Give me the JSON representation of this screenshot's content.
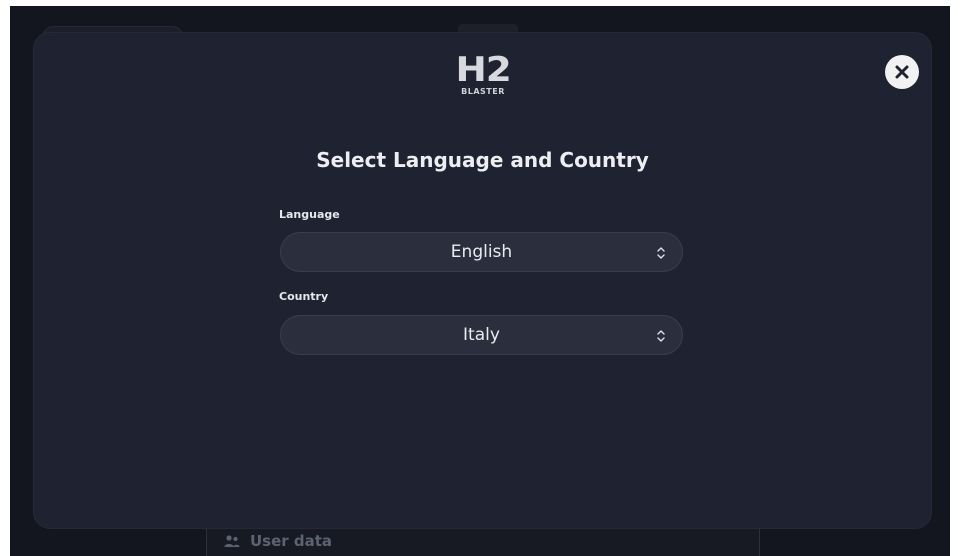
{
  "background": {
    "user_data_label": "User data"
  },
  "modal": {
    "logo": {
      "main": "H2",
      "sub": "BLASTER"
    },
    "title": "Select Language and Country",
    "language": {
      "label": "Language",
      "value": "English"
    },
    "country": {
      "label": "Country",
      "value": "Italy"
    },
    "close_icon": "close-icon"
  },
  "colors": {
    "modal_bg": "#1f2230",
    "select_bg": "#2b2f3d",
    "text": "#eceef2",
    "close_bg": "#f2f2f2"
  }
}
